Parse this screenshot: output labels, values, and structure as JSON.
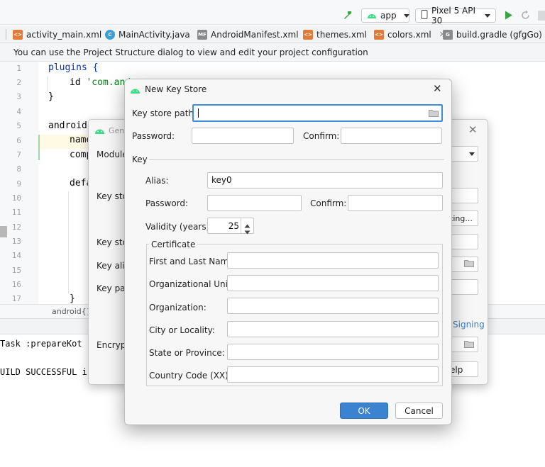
{
  "ide": {
    "run_config": "app",
    "device": "Pixel 5 API 30",
    "tabs": [
      {
        "label": "activity_main.xml",
        "color": "#e07b39"
      },
      {
        "label": "MainActivity.java",
        "color": "#3d9fd5"
      },
      {
        "label": "AndroidManifest.xml",
        "color": "#8a8a8a"
      },
      {
        "label": "themes.xml",
        "color": "#e07b39"
      },
      {
        "label": "colors.xml",
        "color": "#e07b39"
      },
      {
        "label": "build.gradle (gfgGo)",
        "color": "#8a8a8a"
      }
    ],
    "info_bar": "You can use the Project Structure dialog to view and edit your project configuration",
    "line_numbers": [
      "1",
      "2",
      "3",
      "4",
      "5",
      "6",
      "7",
      "8",
      "9",
      "10",
      "11",
      "12",
      "13",
      "14",
      "15",
      "16",
      "17"
    ],
    "code": {
      "l1": "plugins {",
      "l2_kw": "id ",
      "l2_str": "'com.and",
      "l3": "}",
      "l5": "android",
      "l6": "name",
      "l7": "comp",
      "l9": "defa",
      "l17": "}"
    },
    "breadcrumb": "android{}",
    "console": {
      "line1": "Task :prepareKot",
      "line2": "UILD SUCCESSFUL i"
    }
  },
  "background_dialog": {
    "title": "Gene",
    "labels": {
      "module": "Module",
      "key_store1": "Key stor",
      "key_store2": "Key stor",
      "key_alias": "Key alia",
      "key_pass": "Key pas",
      "encrypted": "Encrypte"
    },
    "existing_button": "ting...",
    "signing_link": "Signing",
    "help_button": "elp"
  },
  "dialog": {
    "title": "New Key Store",
    "key_store_path_label": "Key store path:",
    "key_store_path_value": "",
    "password_label": "Password:",
    "confirm_label": "Confirm:",
    "key_section": "Key",
    "alias_label": "Alias:",
    "alias_value": "key0",
    "key_password_label": "Password:",
    "key_confirm_label": "Confirm:",
    "validity_label": "Validity (years):",
    "validity_value": "25",
    "certificate_legend": "Certificate",
    "cert_fields": {
      "first_last": "First and Last Name:",
      "org_unit": "Organizational Unit:",
      "org": "Organization:",
      "city": "City or Locality:",
      "state": "State or Province:",
      "country": "Country Code (XX):"
    },
    "ok_label": "OK",
    "cancel_label": "Cancel"
  },
  "colors": {
    "accent": "#3b82d0",
    "android_green": "#3ddc84",
    "run_green": "#3aa540"
  }
}
